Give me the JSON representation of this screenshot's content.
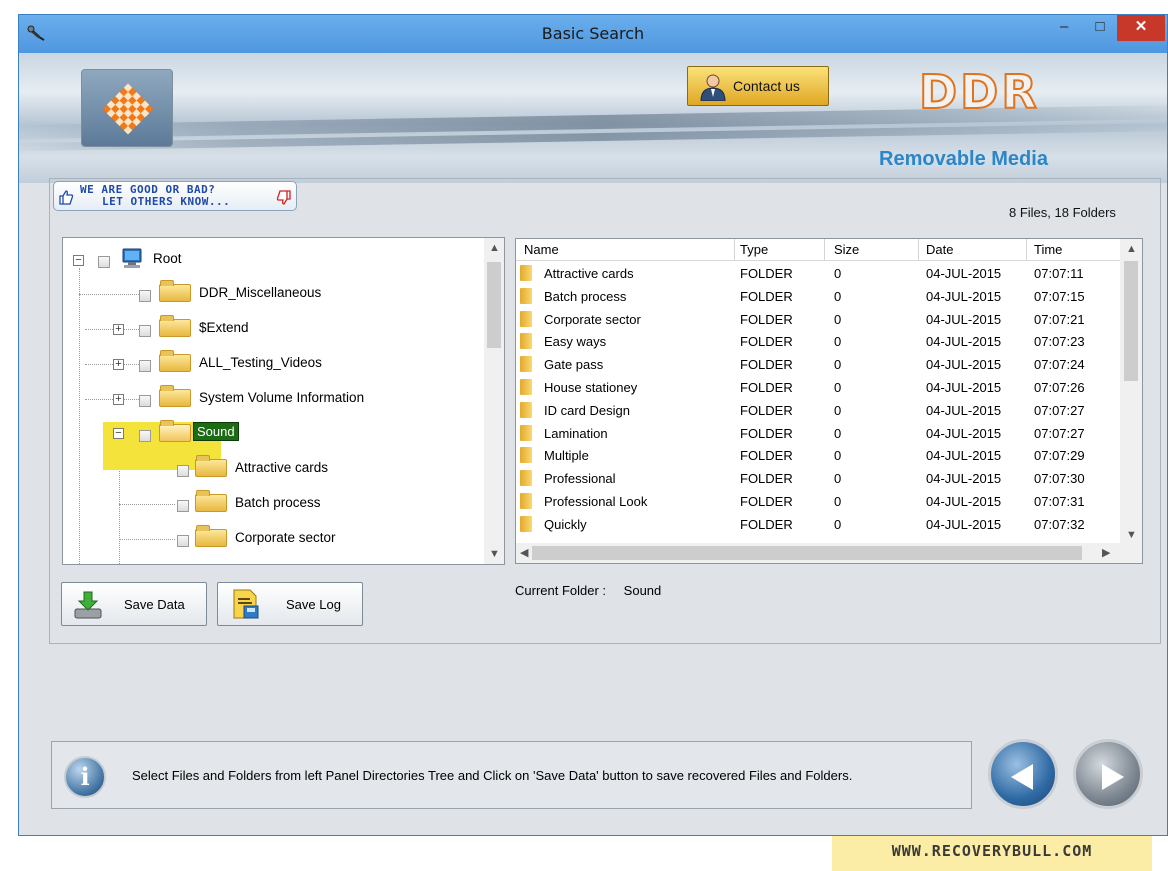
{
  "window": {
    "title": "Basic Search",
    "minimize_glyph": "–",
    "maximize_glyph": "□",
    "close_glyph": "✕"
  },
  "header": {
    "contact_label": "Contact us",
    "brand": "DDR",
    "product": "Removable Media"
  },
  "feedback": {
    "line1": "WE ARE GOOD OR BAD?",
    "line2": "LET OTHERS KNOW..."
  },
  "file_count": "8 Files, 18 Folders",
  "tree": {
    "root": "Root",
    "items": [
      "DDR_Miscellaneous",
      "$Extend",
      "ALL_Testing_Videos",
      "System Volume Information",
      "Sound"
    ],
    "selected": "Sound",
    "children": [
      "Attractive cards",
      "Batch process",
      "Corporate sector"
    ]
  },
  "grid": {
    "columns": [
      "Name",
      "Type",
      "Size",
      "Date",
      "Time"
    ],
    "rows": [
      [
        "Attractive cards",
        "FOLDER",
        "0",
        "04-JUL-2015",
        "07:07:11"
      ],
      [
        "Batch process",
        "FOLDER",
        "0",
        "04-JUL-2015",
        "07:07:15"
      ],
      [
        "Corporate sector",
        "FOLDER",
        "0",
        "04-JUL-2015",
        "07:07:21"
      ],
      [
        "Easy ways",
        "FOLDER",
        "0",
        "04-JUL-2015",
        "07:07:23"
      ],
      [
        "Gate pass",
        "FOLDER",
        "0",
        "04-JUL-2015",
        "07:07:24"
      ],
      [
        "House stationey",
        "FOLDER",
        "0",
        "04-JUL-2015",
        "07:07:26"
      ],
      [
        "ID card Design",
        "FOLDER",
        "0",
        "04-JUL-2015",
        "07:07:27"
      ],
      [
        "Lamination",
        "FOLDER",
        "0",
        "04-JUL-2015",
        "07:07:27"
      ],
      [
        "Multiple",
        "FOLDER",
        "0",
        "04-JUL-2015",
        "07:07:29"
      ],
      [
        "Professional",
        "FOLDER",
        "0",
        "04-JUL-2015",
        "07:07:30"
      ],
      [
        "Professional Look",
        "FOLDER",
        "0",
        "04-JUL-2015",
        "07:07:31"
      ],
      [
        "Quickly",
        "FOLDER",
        "0",
        "04-JUL-2015",
        "07:07:32"
      ]
    ]
  },
  "current_folder": {
    "label": "Current Folder :",
    "value": "Sound"
  },
  "buttons": {
    "save_data": "Save Data",
    "save_log": "Save Log"
  },
  "status": {
    "message": "Select Files and Folders from left Panel Directories Tree and Click on 'Save Data' button to save recovered Files and Folders."
  },
  "watermark": "WWW.RECOVERYBULL.COM"
}
